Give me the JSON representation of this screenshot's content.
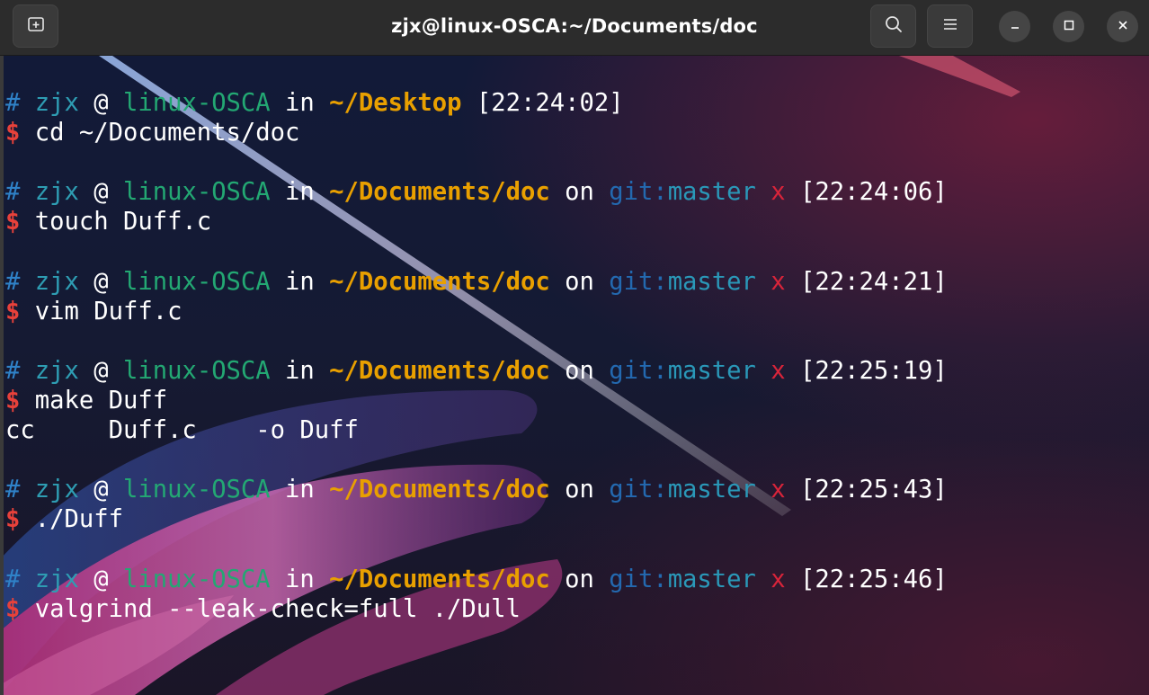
{
  "window": {
    "title": "zjx@linux-OSCA:~/Documents/doc"
  },
  "icons": {
    "new_tab": "new-tab-icon",
    "search": "search-icon",
    "menu": "hamburger-menu-icon",
    "minimize": "minimize-icon",
    "maximize": "maximize-icon",
    "close": "close-icon"
  },
  "colors": {
    "titlebar": "#2c2c2c",
    "hash": "#2f82c8",
    "user": "#2e9db3",
    "host": "#23a873",
    "path": "#e9a000",
    "git": "#2369b0",
    "dirty": "#d8243a",
    "dollar": "#e8413a"
  },
  "terminal": {
    "blocks": [
      {
        "prompt": {
          "hash": "#",
          "user": "zjx",
          "at": "@",
          "host": "linux-OSCA",
          "in": "in",
          "path": "~/Desktop",
          "time": "[22:24:02]"
        },
        "command": {
          "dollar": "$",
          "text": "cd ~/Documents/doc"
        }
      },
      {
        "prompt": {
          "hash": "#",
          "user": "zjx",
          "at": "@",
          "host": "linux-OSCA",
          "in": "in",
          "path": "~/Documents/doc",
          "on": "on",
          "git": "git:",
          "branch": "master",
          "dirty": "x",
          "time": "[22:24:06]"
        },
        "command": {
          "dollar": "$",
          "text": "touch Duff.c"
        }
      },
      {
        "prompt": {
          "hash": "#",
          "user": "zjx",
          "at": "@",
          "host": "linux-OSCA",
          "in": "in",
          "path": "~/Documents/doc",
          "on": "on",
          "git": "git:",
          "branch": "master",
          "dirty": "x",
          "time": "[22:24:21]"
        },
        "command": {
          "dollar": "$",
          "text": "vim Duff.c"
        }
      },
      {
        "prompt": {
          "hash": "#",
          "user": "zjx",
          "at": "@",
          "host": "linux-OSCA",
          "in": "in",
          "path": "~/Documents/doc",
          "on": "on",
          "git": "git:",
          "branch": "master",
          "dirty": "x",
          "time": "[22:25:19]"
        },
        "command": {
          "dollar": "$",
          "text": "make Duff"
        },
        "output": "cc     Duff.c    -o Duff"
      },
      {
        "prompt": {
          "hash": "#",
          "user": "zjx",
          "at": "@",
          "host": "linux-OSCA",
          "in": "in",
          "path": "~/Documents/doc",
          "on": "on",
          "git": "git:",
          "branch": "master",
          "dirty": "x",
          "time": "[22:25:43]"
        },
        "command": {
          "dollar": "$",
          "text": "./Duff"
        }
      },
      {
        "prompt": {
          "hash": "#",
          "user": "zjx",
          "at": "@",
          "host": "linux-OSCA",
          "in": "in",
          "path": "~/Documents/doc",
          "on": "on",
          "git": "git:",
          "branch": "master",
          "dirty": "x",
          "time": "[22:25:46]"
        },
        "command": {
          "dollar": "$",
          "text": "valgrind --leak-check=full ./Dull"
        }
      }
    ]
  }
}
